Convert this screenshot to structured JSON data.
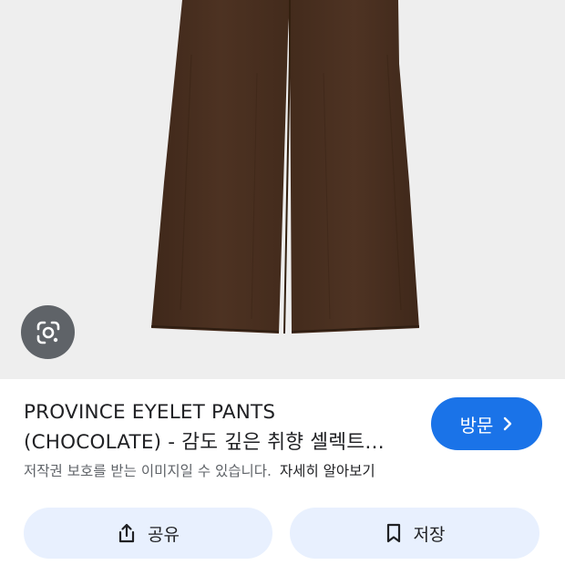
{
  "product": {
    "title_line1": "PROVINCE EYELET PANTS",
    "title_line2": "(CHOCOLATE) - 감도 깊은 취향 셀렉트…"
  },
  "visit_button": {
    "label": "방문",
    "icon": "chevron-right-icon"
  },
  "copyright": {
    "notice": "저작권 보호를 받는 이미지일 수 있습니다.",
    "more_link": "자세히 알아보기"
  },
  "actions": {
    "share_label": "공유",
    "share_icon": "share-icon",
    "save_label": "저장",
    "save_icon": "bookmark-icon"
  },
  "lens": {
    "icon": "google-lens-icon"
  },
  "colors": {
    "accent": "#1a73e8",
    "button_bg": "#e8f0fe",
    "image_bg": "#eeeeee",
    "pants": "#4a3020"
  }
}
